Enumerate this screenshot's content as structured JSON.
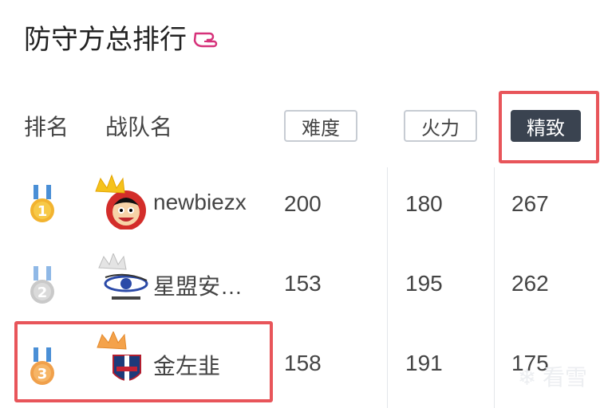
{
  "page": {
    "title": "防守方总排行"
  },
  "table": {
    "headers": {
      "rank": "排名",
      "team": "战队名"
    },
    "sort_buttons": {
      "difficulty": "难度",
      "firepower": "火力",
      "refinement": "精致"
    },
    "active_sort": "精致",
    "rows": [
      {
        "rank": "1",
        "team": "newbiezx",
        "difficulty": "200",
        "firepower": "180",
        "refinement": "267"
      },
      {
        "rank": "2",
        "team": "星盟安…",
        "difficulty": "153",
        "firepower": "195",
        "refinement": "262"
      },
      {
        "rank": "3",
        "team": "金左韭",
        "difficulty": "158",
        "firepower": "191",
        "refinement": "175"
      }
    ]
  },
  "watermark": "看雪",
  "colors": {
    "highlight_border": "#e8555a",
    "active_button": "#3a4350",
    "gold": "#f2b32f",
    "silver": "#c9c9c9",
    "bronze": "#f0a04b"
  },
  "icons": [
    "pointing-hand-icon",
    "gold-medal-icon",
    "silver-medal-icon",
    "bronze-medal-icon",
    "crown-icon",
    "team-avatar-icon",
    "snowflake-icon"
  ]
}
